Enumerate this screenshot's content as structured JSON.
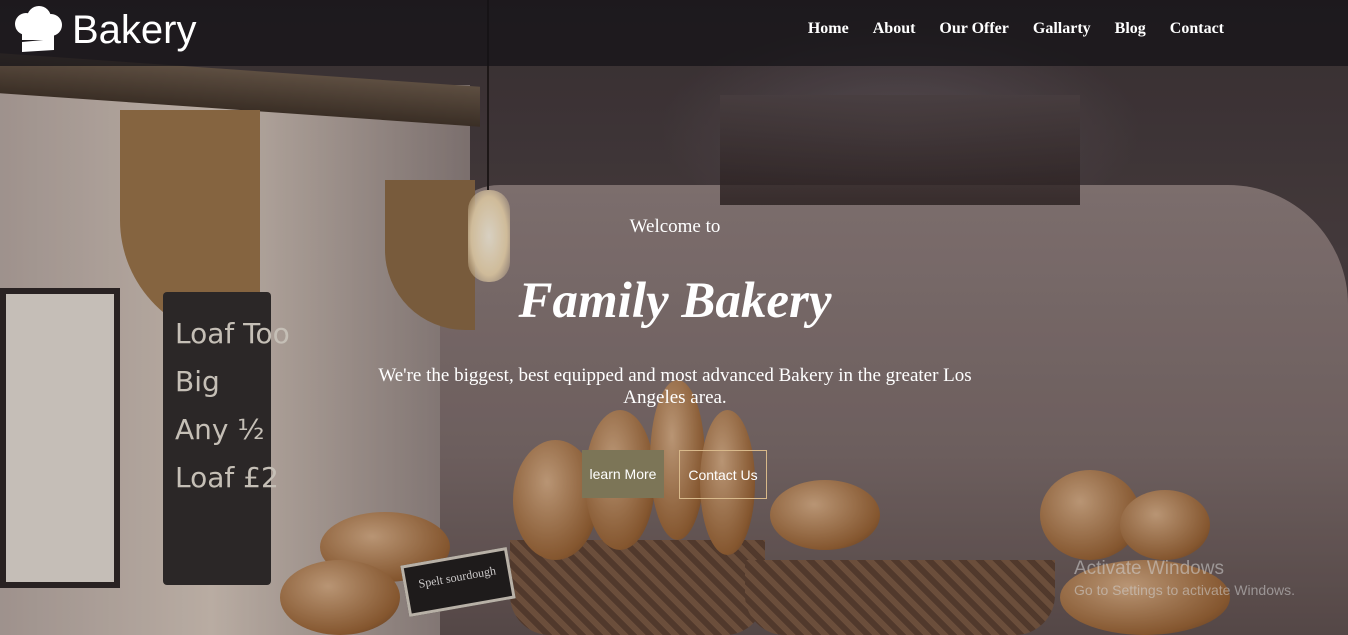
{
  "brand": {
    "name": "Bakery",
    "icon": "chef-hat-icon"
  },
  "nav": {
    "items": [
      {
        "label": "Home"
      },
      {
        "label": "About"
      },
      {
        "label": "Our Offer"
      },
      {
        "label": "Gallarty"
      },
      {
        "label": "Blog"
      },
      {
        "label": "Contact"
      }
    ]
  },
  "hero": {
    "welcome": "Welcome to",
    "title": "Family Bakery",
    "description": "We're the biggest, best equipped and most advanced Bakery in the greater Los Angeles area.",
    "primary_button": "learn More",
    "secondary_button": "Contact Us"
  },
  "background": {
    "chalkboard_text": "Loaf Too\nBig\nAny ½\nLoaf £2",
    "sign_text": "Spelt sourdough"
  },
  "watermark": {
    "title": "Activate Windows",
    "subtitle": "Go to Settings to activate Windows."
  },
  "colors": {
    "primary_button_bg": "#7c7557",
    "secondary_button_border": "#d8b98a",
    "header_bg": "rgba(20,18,22,0.72)"
  }
}
